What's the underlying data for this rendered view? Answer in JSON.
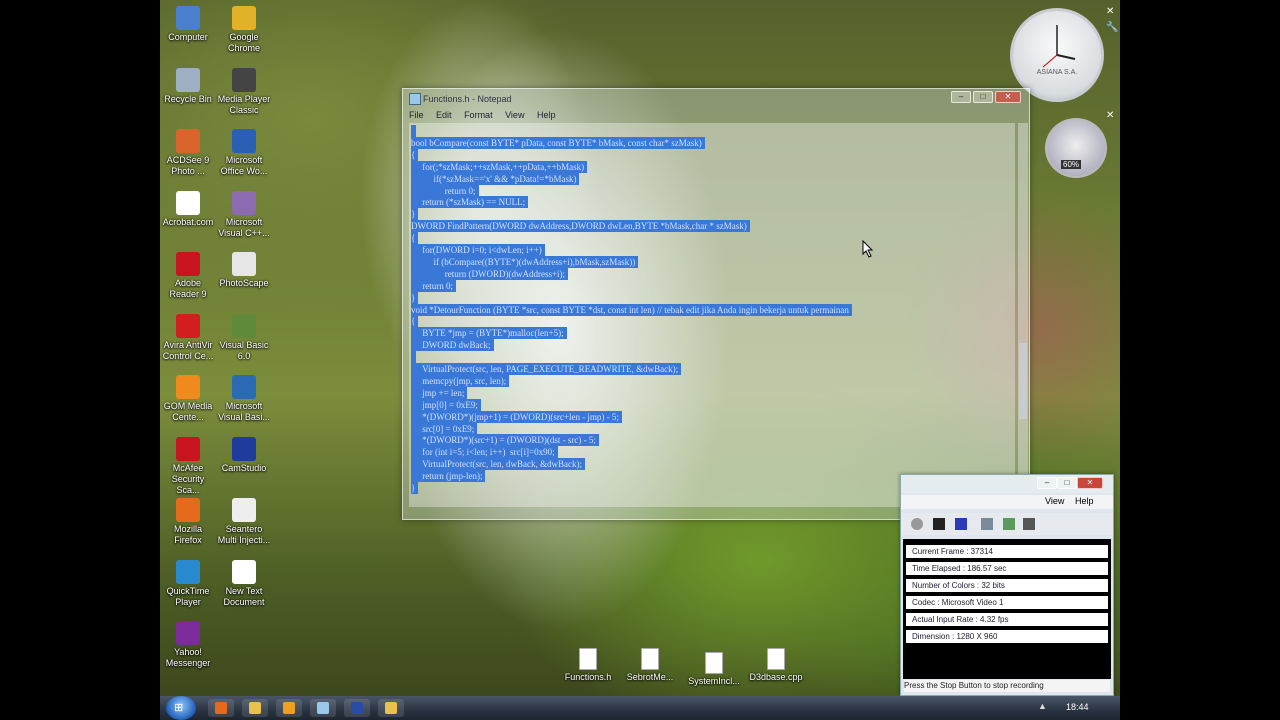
{
  "desktop_icons": [
    {
      "label": "Computer",
      "icon": "computer-icon",
      "color": "#4a7fd0"
    },
    {
      "label": "Google Chrome",
      "icon": "chrome-icon",
      "color": "#e2b12a"
    },
    {
      "label": "Recycle Bin",
      "icon": "recycle-bin-icon",
      "color": "#9fb0c4"
    },
    {
      "label": "Media Player Classic",
      "icon": "media-player-icon",
      "color": "#444444"
    },
    {
      "label": "ACDSee 9 Photo ...",
      "icon": "acdsee-icon",
      "color": "#d9642c"
    },
    {
      "label": "Microsoft Office Wo...",
      "icon": "word-icon",
      "color": "#2b5fb4"
    },
    {
      "label": "Acrobat.com",
      "icon": "acrobat-icon",
      "color": "#ffffff"
    },
    {
      "label": "Microsoft Visual C++...",
      "icon": "visual-cpp-icon",
      "color": "#8c6bb1"
    },
    {
      "label": "Adobe Reader 9",
      "icon": "adobe-reader-icon",
      "color": "#c8141e"
    },
    {
      "label": "PhotoScape",
      "icon": "photoscape-icon",
      "color": "#e6e6e6"
    },
    {
      "label": "Avira AntiVir Control Ce...",
      "icon": "avira-icon",
      "color": "#d21e1e"
    },
    {
      "label": "Visual Basic 6.0",
      "icon": "visual-basic-icon",
      "color": "#5e8a3a"
    },
    {
      "label": "GOM Media Cente...",
      "icon": "gom-icon",
      "color": "#f08a1c"
    },
    {
      "label": "Microsoft Visual Basi...",
      "icon": "ms-visual-basic-icon",
      "color": "#2a6ab4"
    },
    {
      "label": "McAfee Security Sca...",
      "icon": "mcafee-icon",
      "color": "#c8141e"
    },
    {
      "label": "CamStudio",
      "icon": "camstudio-icon",
      "color": "#1e3c9c"
    },
    {
      "label": "Mozilla Firefox",
      "icon": "firefox-icon",
      "color": "#e66a1c"
    },
    {
      "label": "Seantero Multi Injecti...",
      "icon": "injector-icon",
      "color": "#eeeeee"
    },
    {
      "label": "QuickTime Player",
      "icon": "quicktime-icon",
      "color": "#2a8ad0"
    },
    {
      "label": "New Text Document",
      "icon": "text-document-icon",
      "color": "#ffffff"
    },
    {
      "label": "Yahoo! Messenger",
      "icon": "yahoo-messenger-icon",
      "color": "#7b2c9a"
    }
  ],
  "desktop_files": [
    {
      "label": "Functions.h",
      "icon": "file-icon"
    },
    {
      "label": "SebrotMe...",
      "icon": "file-icon"
    },
    {
      "label": "SystemIncl...",
      "icon": "file-icon"
    },
    {
      "label": "D3dbase.cpp",
      "icon": "file-icon"
    }
  ],
  "notepad": {
    "title": "Functions.h - Notepad",
    "menu": [
      "File",
      "Edit",
      "Format",
      "View",
      "Help"
    ],
    "lines": [
      {
        "text": " "
      },
      {
        "text": "bool bCompare(const BYTE* pData, const BYTE* bMask, const char* szMask)"
      },
      {
        "text": "{"
      },
      {
        "text": "     for(;*szMask;++szMask,++pData,++bMask)"
      },
      {
        "text": "          if(*szMask=='x' && *pData!=*bMask)"
      },
      {
        "text": "               return 0;"
      },
      {
        "text": "     return (*szMask) == NULL;"
      },
      {
        "text": "}"
      },
      {
        "text": "DWORD FindPattern(DWORD dwAddress,DWORD dwLen,BYTE *bMask,char * szMask)"
      },
      {
        "text": "{"
      },
      {
        "text": "     for(DWORD i=0; i<dwLen; i++)"
      },
      {
        "text": "          if (bCompare((BYTE*)(dwAddress+i),bMask,szMask))"
      },
      {
        "text": "               return (DWORD)(dwAddress+i);"
      },
      {
        "text": "     return 0;"
      },
      {
        "text": "}"
      },
      {
        "text": "void *DetourFunction (BYTE *src, const BYTE *dst, const int len) // tebak edit jika Anda ingin bekerja untuk permainan"
      },
      {
        "text": "{"
      },
      {
        "text": "     BYTE *jmp = (BYTE*)malloc(len+5);"
      },
      {
        "text": "     DWORD dwBack;"
      },
      {
        "text": " "
      },
      {
        "text": "     VirtualProtect(src, len, PAGE_EXECUTE_READWRITE, &dwBack);"
      },
      {
        "text": "     memcpy(jmp, src, len);"
      },
      {
        "text": "     jmp += len;"
      },
      {
        "text": "     jmp[0] = 0xE9;"
      },
      {
        "text": "     *(DWORD*)(jmp+1) = (DWORD)(src+len - jmp) - 5;"
      },
      {
        "text": "     src[0] = 0xE9;"
      },
      {
        "text": "     *(DWORD*)(src+1) = (DWORD)(dst - src) - 5;"
      },
      {
        "text": "     for (int i=5; i<len; i++)  src[i]=0x90;"
      },
      {
        "text": "     VirtualProtect(src, len, dwBack, &dwBack);"
      },
      {
        "text": "     return (jmp-len);"
      },
      {
        "text": "}"
      }
    ]
  },
  "recorder": {
    "menu": [
      "View",
      "Help"
    ],
    "stats": [
      "Current Frame : 37314",
      "Time Elapsed : 186.57 sec",
      "Number of Colors : 32 bits",
      "Codec : Microsoft Video 1",
      "Actual Input Rate : 4.32 fps",
      "Dimension : 1280 X 960"
    ],
    "status": "Press the Stop Button to stop recording"
  },
  "clock_gadget": {
    "label": "ASIANA S.A."
  },
  "cpu_gadget": {
    "value": "60%"
  },
  "taskbar": {
    "time": "18:44",
    "items": [
      {
        "icon": "firefox-taskbar-icon",
        "color": "#e66a1c"
      },
      {
        "icon": "explorer-taskbar-icon",
        "color": "#e8c24a"
      },
      {
        "icon": "media-taskbar-icon",
        "color": "#f0a020"
      },
      {
        "icon": "notepad-taskbar-icon",
        "color": "#9ac8e8"
      },
      {
        "icon": "camstudio-taskbar-icon",
        "color": "#2a4aa8"
      },
      {
        "icon": "folder-taskbar-icon",
        "color": "#e8c24a"
      }
    ]
  }
}
